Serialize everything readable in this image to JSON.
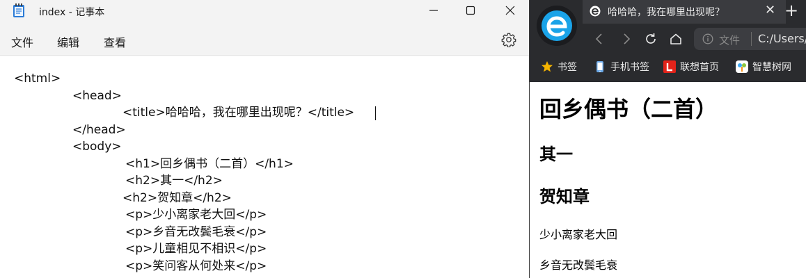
{
  "notepad": {
    "title": "index - 记事本",
    "menu": {
      "file": "文件",
      "edit": "编辑",
      "view": "查看"
    },
    "lines": [
      "<html>",
      "<head>",
      "<title>哈哈哈，我在哪里出现呢？</title>",
      "</head>",
      "<body>",
      "<h1>回乡偶书（二首）</h1>",
      "<h2>其一</h2>",
      "<h2>贺知章</h2>",
      "<p>少小离家老大回</p>",
      "<p>乡音无改鬓毛衰</p>",
      "<p>儿童相见不相识</p>",
      "<p>笑问客从何处来</p>"
    ]
  },
  "browser": {
    "tab_title": "哈哈哈，我在哪里出现呢？",
    "address": {
      "label": "文件",
      "url": "C:/Users/"
    },
    "bookmarks": [
      "书签",
      "手机书签",
      "联想首页",
      "智慧树网"
    ],
    "page": {
      "h1": "回乡偶书（二首）",
      "h2": [
        "其一",
        "贺知章"
      ],
      "paragraphs": [
        "少小离家老大回",
        "乡音无改鬓毛衰"
      ]
    }
  },
  "colors": {
    "browser_chrome": "#2a2b2e",
    "edge_logo_blue": "#1aa3e8",
    "bookmark_star": "#f5b400",
    "lenovo_red": "#e2231a"
  }
}
